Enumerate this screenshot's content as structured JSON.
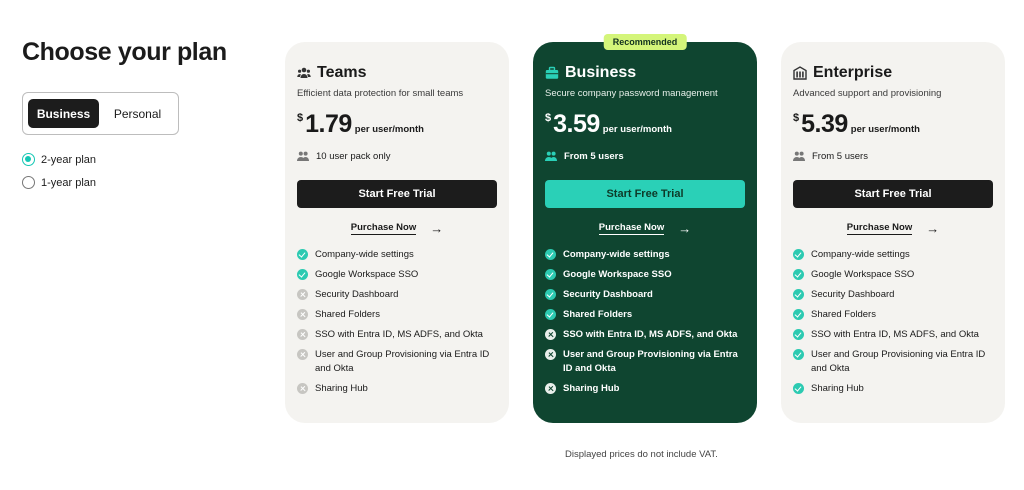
{
  "page": {
    "title": "Choose your plan",
    "vat_note": "Displayed prices do not include VAT."
  },
  "segment": {
    "business": "Business",
    "personal": "Personal",
    "selected": "Business"
  },
  "billing": {
    "options": [
      "2-year plan",
      "1-year plan"
    ],
    "selected": "2-year plan"
  },
  "plans": [
    {
      "name": "Teams",
      "icon": "team-icon",
      "description": "Efficient data protection for small teams",
      "currency": "$",
      "price": "1.79",
      "unit": "per user/month",
      "users": "10 user pack only",
      "cta": "Start Free Trial",
      "purchase": "Purchase Now",
      "features": [
        {
          "label": "Company-wide settings",
          "included": true
        },
        {
          "label": "Google Workspace SSO",
          "included": true
        },
        {
          "label": "Security Dashboard",
          "included": false
        },
        {
          "label": "Shared Folders",
          "included": false
        },
        {
          "label": "SSO with Entra ID, MS ADFS, and Okta",
          "included": false
        },
        {
          "label": "User and Group Provisioning via Entra ID and Okta",
          "included": false
        },
        {
          "label": "Sharing Hub",
          "included": false
        }
      ]
    },
    {
      "name": "Business",
      "icon": "briefcase-icon",
      "badge": "Recommended",
      "description": "Secure company password management",
      "currency": "$",
      "price": "3.59",
      "unit": "per user/month",
      "users": "From 5 users",
      "cta": "Start Free Trial",
      "purchase": "Purchase Now",
      "features": [
        {
          "label": "Company-wide settings",
          "included": true
        },
        {
          "label": "Google Workspace SSO",
          "included": true
        },
        {
          "label": "Security Dashboard",
          "included": true
        },
        {
          "label": "Shared Folders",
          "included": true
        },
        {
          "label": "SSO with Entra ID, MS ADFS, and Okta",
          "included": false
        },
        {
          "label": "User and Group Provisioning via Entra ID and Okta",
          "included": false
        },
        {
          "label": "Sharing Hub",
          "included": false
        }
      ]
    },
    {
      "name": "Enterprise",
      "icon": "building-icon",
      "description": "Advanced support and provisioning",
      "currency": "$",
      "price": "5.39",
      "unit": "per user/month",
      "users": "From 5 users",
      "cta": "Start Free Trial",
      "purchase": "Purchase Now",
      "features": [
        {
          "label": "Company-wide settings",
          "included": true
        },
        {
          "label": "Google Workspace SSO",
          "included": true
        },
        {
          "label": "Security Dashboard",
          "included": true
        },
        {
          "label": "Shared Folders",
          "included": true
        },
        {
          "label": "SSO with Entra ID, MS ADFS, and Okta",
          "included": true
        },
        {
          "label": "User and Group Provisioning via Entra ID and Okta",
          "included": true
        },
        {
          "label": "Sharing Hub",
          "included": true
        }
      ]
    }
  ],
  "colors": {
    "accent": "#2ccab1",
    "dark_card": "#0f4530",
    "badge": "#d4f57a",
    "cta_dark": "#1c1c1c"
  }
}
